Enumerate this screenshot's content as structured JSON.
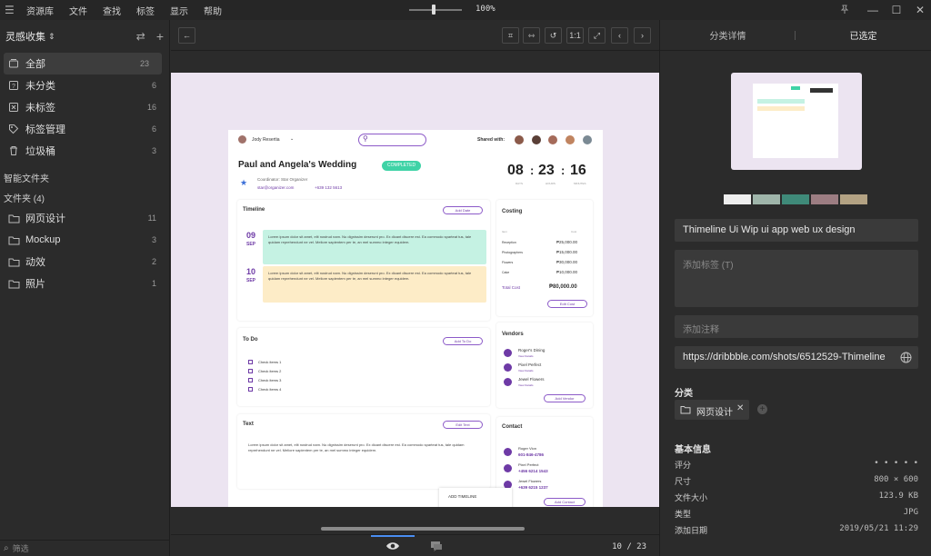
{
  "menu": [
    "资源库",
    "文件",
    "查找",
    "标签",
    "显示",
    "帮助"
  ],
  "zoom_level": "100%",
  "sidebar": {
    "library_name": "灵感收集",
    "items": [
      {
        "label": "全部",
        "count": "23"
      },
      {
        "label": "未分类",
        "count": "6"
      },
      {
        "label": "未标签",
        "count": "16"
      },
      {
        "label": "标签管理",
        "count": "6"
      },
      {
        "label": "垃圾桶",
        "count": "3"
      }
    ],
    "smart_folders_label": "智能文件夹",
    "folders_label": "文件夹 (4)",
    "folders": [
      {
        "label": "网页设计",
        "count": "11"
      },
      {
        "label": "Mockup",
        "count": "3"
      },
      {
        "label": "动效",
        "count": "2"
      },
      {
        "label": "照片",
        "count": "1"
      }
    ],
    "filter_placeholder": "筛选"
  },
  "toolbar": {
    "one_to_one": "1:1"
  },
  "viewer": {
    "page_indicator": "10 / 23",
    "mock": {
      "user": "Jody Resertia",
      "shared_with": "Shared with:",
      "title": "Paul and Angela's Wedding",
      "status": "COMPLETED",
      "coordinator": "Coordinator: Star Organizer",
      "email": "star@organizer.com",
      "phone": "+639 132 5613",
      "timer": [
        "08",
        "23",
        "16"
      ],
      "timer_labels": [
        "DAYS",
        "HOURS",
        "MINUTES"
      ],
      "timeline": {
        "title": "Timeline",
        "add": "Add Date",
        "entries": [
          {
            "day": "09",
            "month": "SEP",
            "text": "Lorem ipsum dolor sit amet, elit nostrud nam. Nu dignissim deserunt pro. Ex dicant discere est. Ea commodo sparteat tus, tale quidam reprehendunt ne vel. Meliore sapientem per te, an mel summo integer equidem."
          },
          {
            "day": "10",
            "month": "SEP",
            "text": "Lorem ipsum dolor sit amet, elit nostrud nam. Nu dignissim deserunt pro. Ex dicant discere est. Ea commodo sparteat tus, tale quidam reprehendunt ne vel. Meliore sapientem per te, an mel summo integer equidem."
          }
        ]
      },
      "costing": {
        "title": "Costing",
        "col1": "Item",
        "col2": "Cost",
        "rows": [
          {
            "item": "Reception",
            "cost": "₱25,000.00"
          },
          {
            "item": "Photographers",
            "cost": "₱15,000.00"
          },
          {
            "item": "Flowers",
            "cost": "₱30,000.00"
          },
          {
            "item": "Cake",
            "cost": "₱10,000.00"
          }
        ],
        "total_label": "Total Cost",
        "total": "₱80,000.00",
        "edit": "Edit Cost"
      },
      "todo": {
        "title": "To Do",
        "add": "Add To Do",
        "items": [
          "Check items 1",
          "Check items 2",
          "Check items 3",
          "Check items 4"
        ]
      },
      "vendors": {
        "title": "Vendors",
        "items": [
          {
            "name": "Roger's Dining",
            "sub": "View Details"
          },
          {
            "name": "Pixel Perfect",
            "sub": "View Details"
          },
          {
            "name": "Jewel Flowers",
            "sub": "View Details"
          }
        ],
        "add": "Add Vendor"
      },
      "text_card": {
        "title": "Text",
        "edit": "Edit Text",
        "body": "Lorem ipsum dolor sit amet, elit nostrud nam. Nu dignissim deserunt pro. Ex dicant discere est. Ea commodo sparteat tus, tale quidam reprehendunt ne vel. Meliore sapientem per te, an mel summo integer equidem."
      },
      "contact": {
        "title": "Contact",
        "items": [
          {
            "name": "Roger Vion",
            "phone": "601-846-4786"
          },
          {
            "name": "Pixel Perfect",
            "phone": "+456 6214 1543"
          },
          {
            "name": "Jewel Flowers",
            "phone": "+639 6215 1237"
          }
        ],
        "add": "Add Contact"
      },
      "add_timeline": "ADD TIMELINE"
    }
  },
  "right_panel": {
    "tab_details": "分类详情",
    "tab_selected": "已选定",
    "swatches": [
      "#eeeeee",
      "#9fb5aa",
      "#3f8a79",
      "#9c7d82",
      "#b3a283"
    ],
    "title_value": "Thimeline Ui  Wip ui app web ux design",
    "tags_placeholder": "添加标签 (T)",
    "notes_placeholder": "添加注释",
    "url_value": "https://dribbble.com/shots/6512529-Thimeline",
    "category_label": "分类",
    "category_tag": "网页设计",
    "basic_info_label": "基本信息",
    "info": [
      {
        "key": "评分",
        "value": "• • • • •"
      },
      {
        "key": "尺寸",
        "value": "800 × 600"
      },
      {
        "key": "文件大小",
        "value": "123.9 KB"
      },
      {
        "key": "类型",
        "value": "JPG"
      },
      {
        "key": "添加日期",
        "value": "2019/05/21 11:29"
      }
    ]
  }
}
